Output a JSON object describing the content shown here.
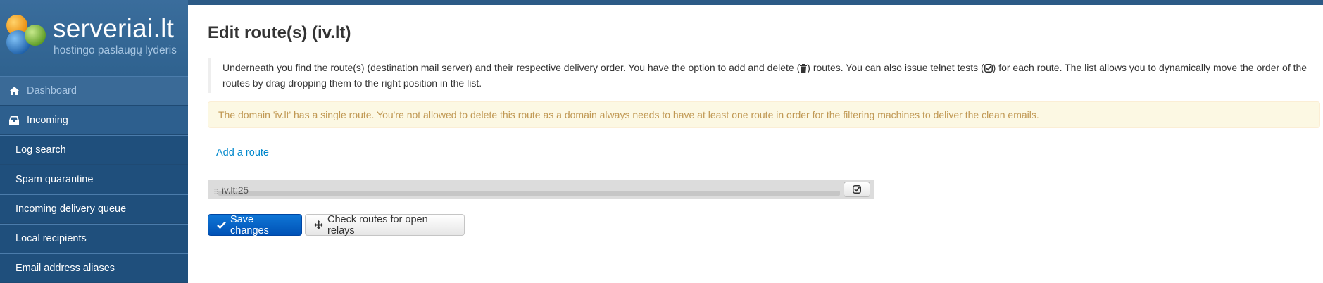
{
  "brand": {
    "name": "serveriai.lt",
    "tagline": "hostingo paslaugų lyderis",
    "colors": {
      "orange": "#f5a81f",
      "blue": "#2f86d6",
      "green": "#7ab83a"
    }
  },
  "sidebar": {
    "items": [
      {
        "label": "Dashboard",
        "icon": "home-icon"
      },
      {
        "label": "Incoming",
        "icon": "inbox-icon"
      },
      {
        "label": "Log search"
      },
      {
        "label": "Spam quarantine"
      },
      {
        "label": "Incoming delivery queue"
      },
      {
        "label": "Local recipients"
      },
      {
        "label": "Email address aliases"
      }
    ]
  },
  "main": {
    "title": "Edit route(s) (iv.lt)",
    "description": {
      "part1": "Underneath you find the route(s) (destination mail server) and their respective delivery order. You have the option to add and delete (",
      "part2": ") routes. You can also issue telnet tests (",
      "part3": ") for each route. The list allows you to dynamically move the order of the routes by drag dropping them to the right position in the list."
    },
    "alert": "The domain 'iv.lt' has a single route. You're not allowed to delete this route as a domain always needs to have at least one route in order for the filtering machines to deliver the clean emails.",
    "add_route_label": "Add a route",
    "routes": [
      {
        "label": "iv.lt:25"
      }
    ],
    "save_label": "Save changes",
    "check_label": "Check routes for open relays"
  },
  "colors": {
    "accent": "#0088cc",
    "primary_button": "#0066cc",
    "alert_bg": "#fcf8e3",
    "alert_text": "#c09853",
    "sidebar_bg": "#2b5d8d"
  }
}
